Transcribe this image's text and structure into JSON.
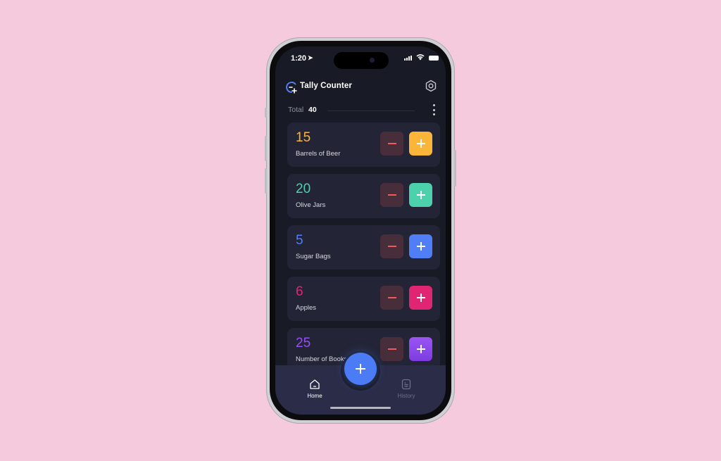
{
  "status_bar": {
    "time": "1:20"
  },
  "header": {
    "title": "Tally Counter"
  },
  "summary": {
    "total_label": "Total",
    "total_value": "40"
  },
  "counters": [
    {
      "count": "15",
      "name": "Barrels of Beer",
      "color": "#fbb63a"
    },
    {
      "count": "20",
      "name": "Olive Jars",
      "color": "#4dd1ad"
    },
    {
      "count": "5",
      "name": "Sugar Bags",
      "color": "#4f7ef6"
    },
    {
      "count": "6",
      "name": "Apples",
      "color": "#e02672"
    },
    {
      "count": "25",
      "name": "Number of Books",
      "color": "#9551f1"
    }
  ],
  "colors": {
    "minus_bg": "#482d3a",
    "minus_glyph": "#ef5a5a",
    "fab": "#4b7cf5",
    "background": "#f6cadd"
  },
  "nav": {
    "home_label": "Home",
    "history_label": "History"
  }
}
